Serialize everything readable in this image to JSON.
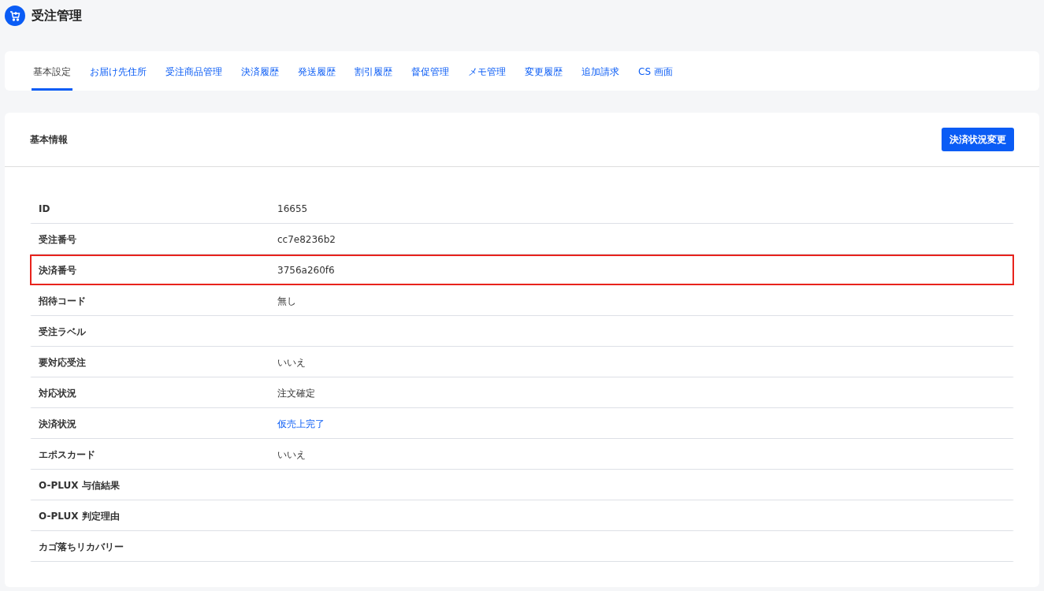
{
  "header": {
    "title": "受注管理"
  },
  "tabs": [
    {
      "label": "基本設定",
      "selected": true
    },
    {
      "label": "お届け先住所",
      "selected": false
    },
    {
      "label": "受注商品管理",
      "selected": false
    },
    {
      "label": "決済履歴",
      "selected": false
    },
    {
      "label": "発送履歴",
      "selected": false
    },
    {
      "label": "割引履歴",
      "selected": false
    },
    {
      "label": "督促管理",
      "selected": false
    },
    {
      "label": "メモ管理",
      "selected": false
    },
    {
      "label": "変更履歴",
      "selected": false
    },
    {
      "label": "追加請求",
      "selected": false
    },
    {
      "label": "CS 画面",
      "selected": false
    }
  ],
  "panel": {
    "title": "基本情報",
    "action_button": "決済状況変更",
    "rows": [
      {
        "label": "ID",
        "value": "16655",
        "kind": "text",
        "highlighted": false
      },
      {
        "label": "受注番号",
        "value": "cc7e8236b2",
        "kind": "text",
        "highlighted": false
      },
      {
        "label": "決済番号",
        "value": "3756a260f6",
        "kind": "text",
        "highlighted": true
      },
      {
        "label": "招待コード",
        "value": "無し",
        "kind": "text",
        "highlighted": false
      },
      {
        "label": "受注ラベル",
        "highlighted": false
      },
      {
        "label": "要対応受注",
        "value": "いいえ",
        "kind": "text",
        "highlighted": false
      },
      {
        "label": "対応状況",
        "value": "注文確定",
        "kind": "text",
        "highlighted": false
      },
      {
        "label": "決済状況",
        "value": "仮売上完了",
        "kind": "link",
        "highlighted": false
      },
      {
        "label": "エポスカード",
        "value": "いいえ",
        "kind": "text",
        "highlighted": false
      },
      {
        "label": "O-PLUX 与信結果",
        "highlighted": false
      },
      {
        "label": "O-PLUX 判定理由",
        "highlighted": false
      },
      {
        "label": "カゴ落ちリカバリー",
        "highlighted": false
      }
    ]
  }
}
